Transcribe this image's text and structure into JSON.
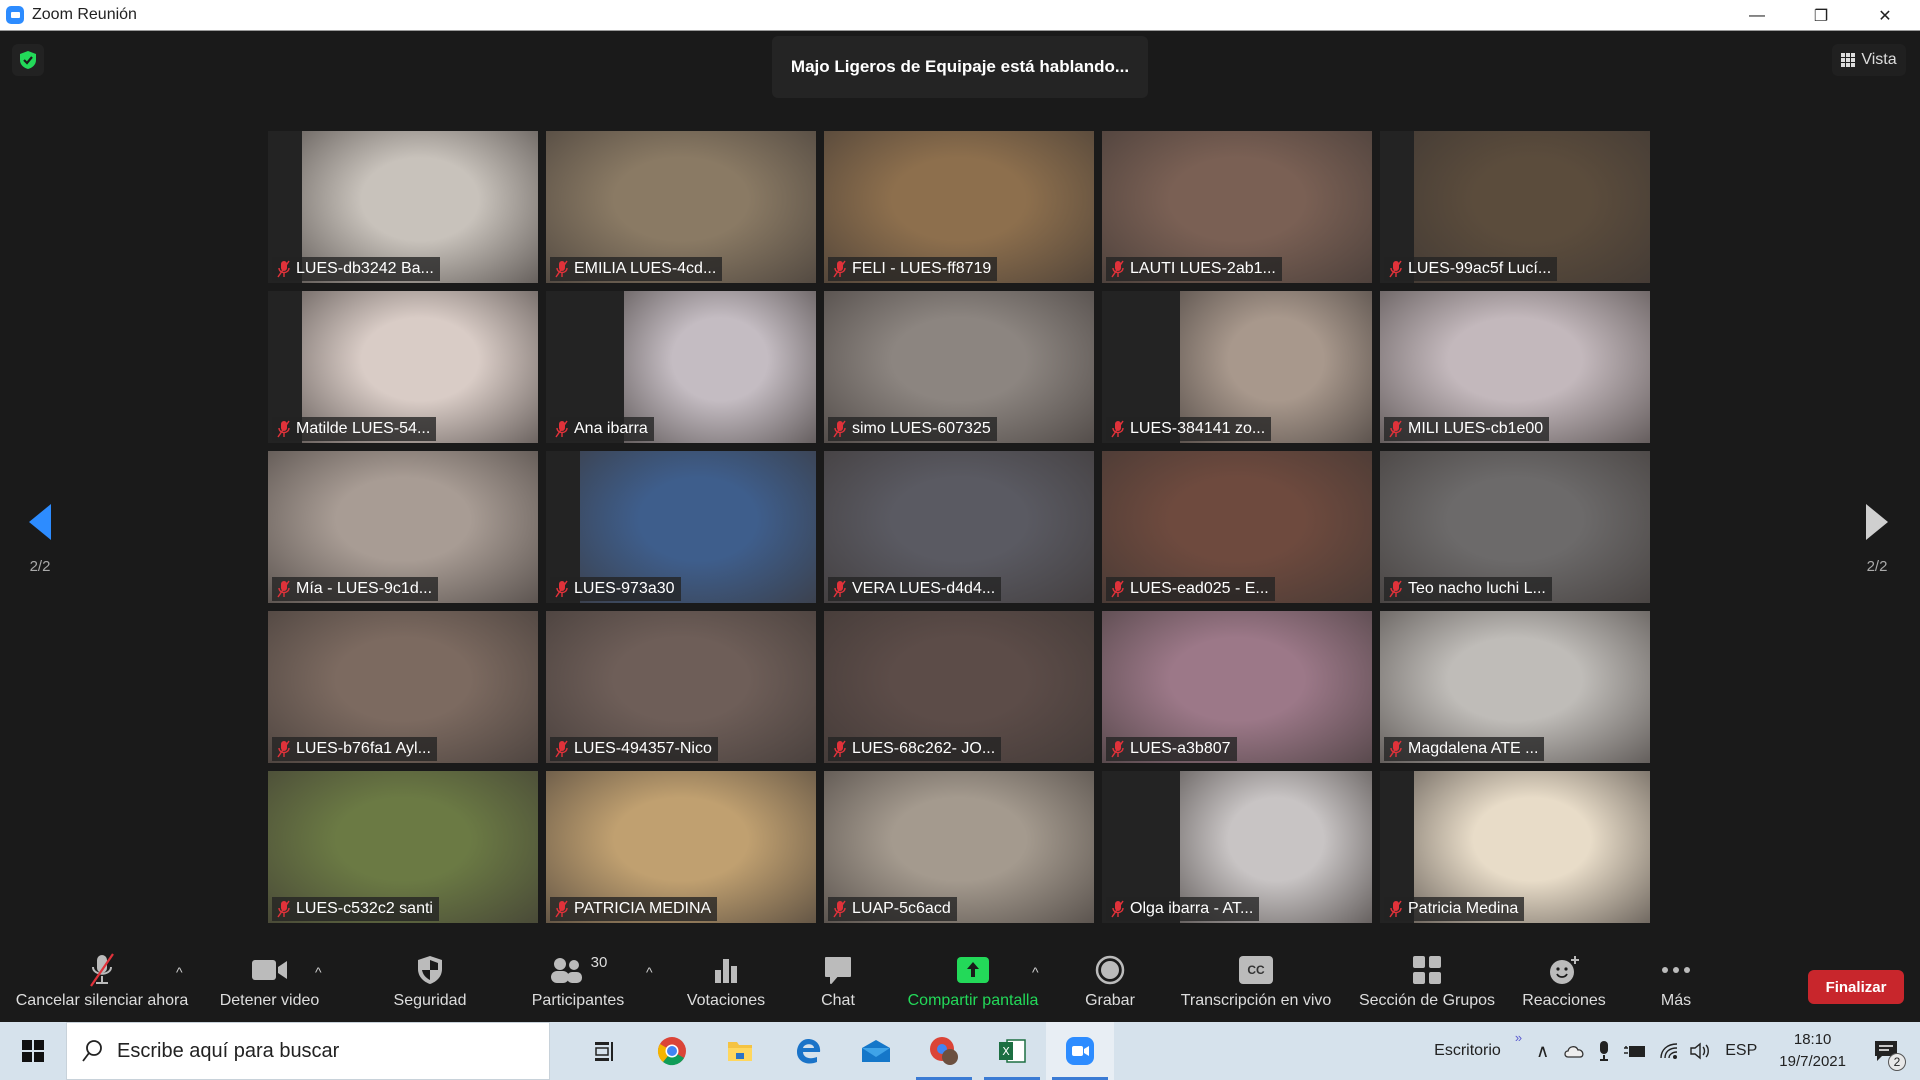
{
  "window": {
    "title": "Zoom Reunión",
    "controls": {
      "minimize": "—",
      "restore": "❐",
      "close": "✕"
    }
  },
  "meeting": {
    "security_icon": "shield-check-icon",
    "speaking_banner": "Majo Ligeros de Equipaje está hablando...",
    "view_button": "Vista",
    "page_indicator_left": "2/2",
    "page_indicator_right": "2/2",
    "participants": [
      {
        "name": "LUES-db3242 Ba...",
        "muted": true,
        "video_color": "#c8c2bb"
      },
      {
        "name": "EMILIA LUES-4cd...",
        "muted": true,
        "video_color": "#8a7a64"
      },
      {
        "name": "FELI - LUES-ff8719",
        "muted": true,
        "video_color": "#8d6f4d"
      },
      {
        "name": "LAUTI LUES-2ab1...",
        "muted": true,
        "video_color": "#7a6054"
      },
      {
        "name": "LUES-99ac5f Lucí...",
        "muted": true,
        "video_color": "#5b4c3c"
      },
      {
        "name": "Matilde LUES-54...",
        "muted": true,
        "video_color": "#d9ccc6"
      },
      {
        "name": "Ana ibarra",
        "muted": true,
        "video_color": "#c4bcc2"
      },
      {
        "name": "simo LUES-607325",
        "muted": true,
        "video_color": "#8c8580"
      },
      {
        "name": "LUES-384141 zo...",
        "muted": true,
        "video_color": "#a8988c"
      },
      {
        "name": "MILI  LUES-cb1e00",
        "muted": true,
        "video_color": "#c3b8bc"
      },
      {
        "name": "Mía - LUES-9c1d...",
        "muted": true,
        "video_color": "#a89c94"
      },
      {
        "name": "LUES-973a30",
        "muted": true,
        "video_color": "#3e5e8c"
      },
      {
        "name": "VERA LUES-d4d4...",
        "muted": true,
        "video_color": "#5a5a62"
      },
      {
        "name": "LUES-ead025 - E...",
        "muted": true,
        "video_color": "#6e4a3e"
      },
      {
        "name": "Teo nacho luchi L...",
        "muted": true,
        "video_color": "#6c6a6a"
      },
      {
        "name": "LUES-b76fa1 Ayl...",
        "muted": true,
        "video_color": "#7c6a60"
      },
      {
        "name": "LUES-494357-Nico",
        "muted": true,
        "video_color": "#6e5e58"
      },
      {
        "name": "LUES-68c262- JO...",
        "muted": true,
        "video_color": "#5c4c48"
      },
      {
        "name": "LUES-a3b807",
        "muted": true,
        "video_color": "#9c7888"
      },
      {
        "name": "Magdalena ATE ...",
        "muted": true,
        "video_color": "#bfbcb8"
      },
      {
        "name": "LUES-c532c2 santi",
        "muted": true,
        "video_color": "#6b7a44"
      },
      {
        "name": "PATRICIA MEDINA",
        "muted": true,
        "video_color": "#c0a070"
      },
      {
        "name": "LUAP-5c6acd",
        "muted": true,
        "video_color": "#a49a8e"
      },
      {
        "name": "Olga ibarra - AT...",
        "muted": true,
        "video_color": "#c8c4c4"
      },
      {
        "name": "Patricia Medina",
        "muted": true,
        "video_color": "#e8dcc8"
      }
    ]
  },
  "toolbar": {
    "mute": "Cancelar silenciar ahora",
    "video": "Detener video",
    "security": "Seguridad",
    "participants": "Participantes",
    "participants_count": "30",
    "polls": "Votaciones",
    "chat": "Chat",
    "share": "Compartir pantalla",
    "record": "Grabar",
    "cc_badge": "CC",
    "transcription": "Transcripción en vivo",
    "breakout": "Sección de Grupos",
    "reactions": "Reacciones",
    "more": "Más",
    "end": "Finalizar",
    "share_color": "#23d959",
    "end_color": "#c8262c"
  },
  "taskbar": {
    "search_placeholder": "Escribe aquí para buscar",
    "desktop_label": "Escritorio",
    "language": "ESP",
    "time": "18:10",
    "date": "19/7/2021",
    "notification_count": "2",
    "apps": [
      "task-view",
      "chrome",
      "file-explorer",
      "edge",
      "mail",
      "chrome-profile",
      "excel",
      "zoom"
    ]
  }
}
